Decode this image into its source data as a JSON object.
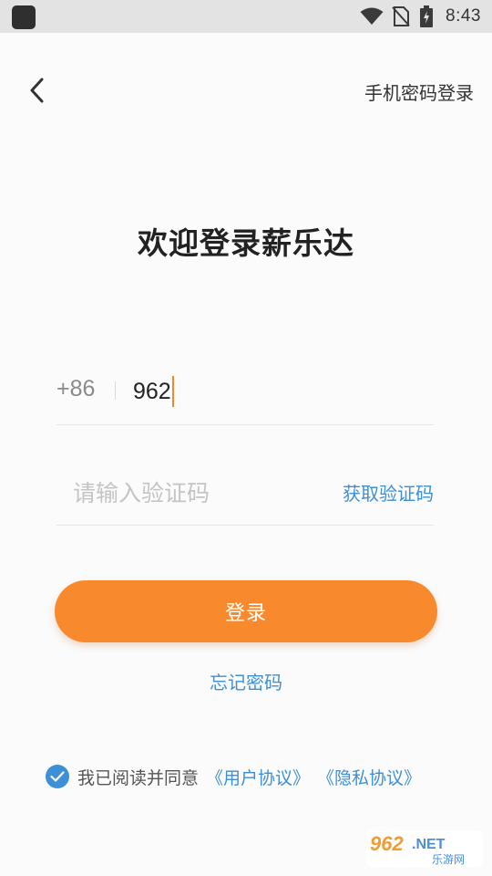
{
  "status_bar": {
    "time": "8:43",
    "icons": [
      "app-icon",
      "wifi-icon",
      "no-sim-icon",
      "battery-charging-icon"
    ]
  },
  "header": {
    "back_icon": "chevron-left-icon",
    "alt_login_label": "手机密码登录"
  },
  "title": "欢迎登录薪乐达",
  "form": {
    "country_code": "+86",
    "phone_value": "962",
    "code_placeholder": "请输入验证码",
    "code_value": "",
    "get_code_label": "获取验证码"
  },
  "login_button_label": "登录",
  "forgot_password_label": "忘记密码",
  "agreement": {
    "checked": true,
    "text": "我已阅读并同意",
    "user_agreement": "《用户协议》",
    "privacy_agreement": "《隐私协议》"
  },
  "watermark": {
    "text": "962.NET",
    "subtext": "乐游网"
  },
  "colors": {
    "accent_orange": "#f88a2d",
    "link_blue": "#3d8fd6",
    "caret": "#f5882a"
  }
}
